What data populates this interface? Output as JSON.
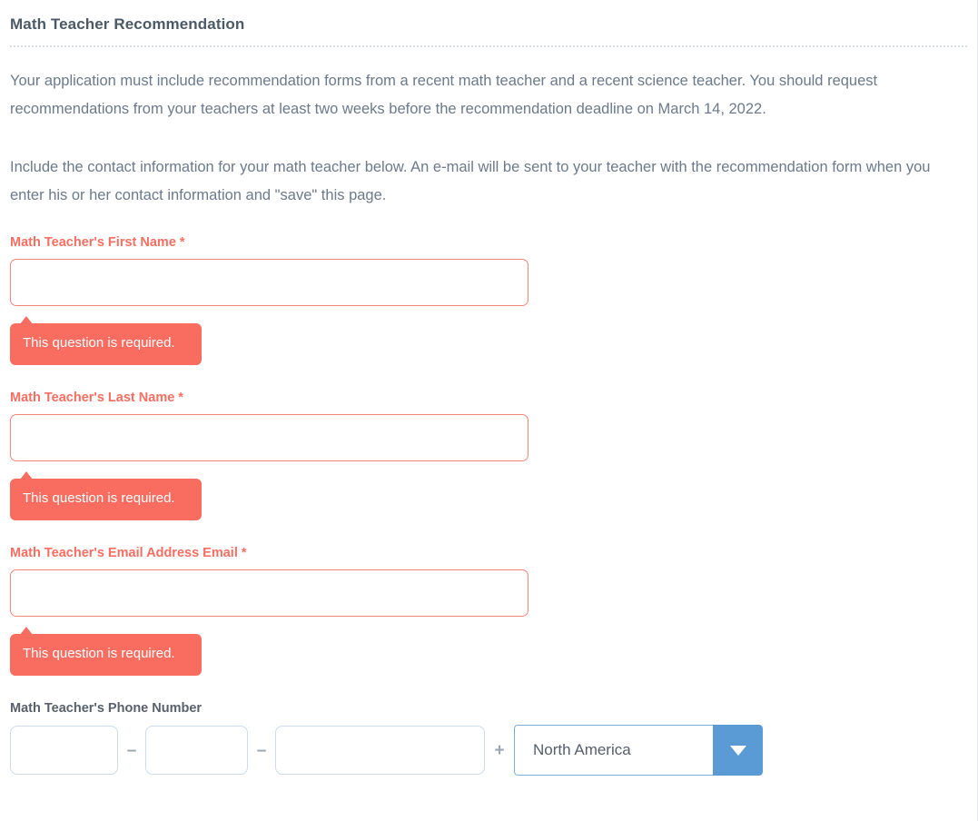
{
  "header": {
    "title": "Math Teacher Recommendation"
  },
  "intro": {
    "paragraph_1": "Your application must include recommendation forms from a recent math teacher and a recent science teacher. You should request recommendations from your teachers at least two weeks before the recommendation deadline on March 14, 2022.",
    "paragraph_2": "Include the contact information for your math teacher below. An e-mail will be sent to your teacher with the recommendation form when you enter his or her contact information and \"save\" this page."
  },
  "form": {
    "first_name": {
      "label": "Math Teacher's First Name *",
      "value": "",
      "error": "This question is required."
    },
    "last_name": {
      "label": "Math Teacher's Last Name *",
      "value": "",
      "error": "This question is required."
    },
    "email": {
      "label": "Math Teacher's Email Address Email *",
      "value": "",
      "error": "This question is required."
    },
    "phone": {
      "label": "Math Teacher's Phone Number",
      "area_code": "",
      "prefix": "",
      "line_number": "",
      "separator_1": "–",
      "separator_2": "–",
      "plus_symbol": "+",
      "region_selected": "North America",
      "region_options": [
        "North America"
      ],
      "dropdown_icon": "chevron-down-icon"
    }
  },
  "colors": {
    "error_accent": "#f96d60",
    "error_border": "#f2847a",
    "label_required": "#f76e62",
    "label_normal": "#58616b",
    "title": "#4c5a67",
    "body_text": "#6c7a89",
    "input_border": "#cddce8",
    "select_blue": "#5b9bd5",
    "select_border_blue": "#7aaddb"
  }
}
